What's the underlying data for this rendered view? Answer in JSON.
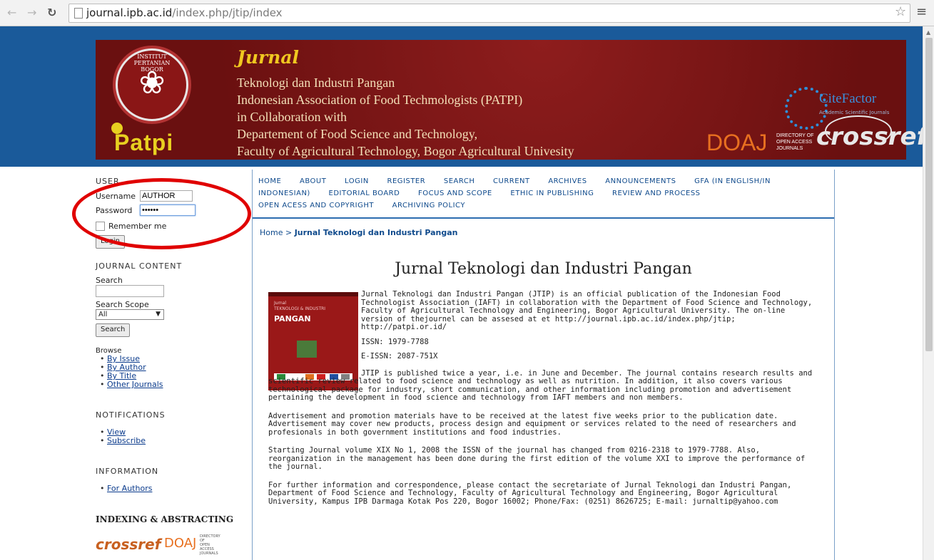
{
  "browser": {
    "url_host": "journal.ipb.ac.id",
    "url_path": "/index.php/jtip/index",
    "back_icon": "arrow-left",
    "forward_icon": "arrow-right",
    "reload_icon": "reload"
  },
  "banner": {
    "title": "Jurnal",
    "lines": [
      "Teknologi dan Industri Pangan",
      "Indonesian Association of Food Techmologists (PATPI)",
      "in Collaboration with",
      "Departement of Food Science and Technology,",
      "Faculty of Agricultural Technology, Bogor Agricultural Univesity"
    ],
    "crest_text": "INSTITUT PERTANIAN BOGOR",
    "patpi_logo": "Patpi",
    "citefactor": "CiteFactor",
    "citefactor_sub": "Academic Scientific Journals",
    "doaj": "DOAJ",
    "doaj_sub": [
      "DIRECTORY OF",
      "OPEN ACCESS",
      "JOURNALS"
    ],
    "crossref": "crossref"
  },
  "sidebar": {
    "user_title": "USER",
    "username_label": "Username",
    "username_value": "AUTHOR",
    "password_label": "Password",
    "password_value": "••••••",
    "remember_label": "Remember me",
    "login_button": "Login",
    "journal_content_title": "JOURNAL CONTENT",
    "search_label": "Search",
    "search_scope_label": "Search Scope",
    "search_scope_value": "All",
    "search_button": "Search",
    "browse_label": "Browse",
    "browse_links": [
      "By Issue",
      "By Author",
      "By Title",
      "Other Journals"
    ],
    "notifications_title": "NOTIFICATIONS",
    "notification_links": [
      "View",
      "Subscribe"
    ],
    "information_title": "INFORMATION",
    "information_links": [
      "For Authors"
    ],
    "indexing_title": "INDEXING & ABSTRACTING",
    "indexing_crossref": "crossref",
    "indexing_doaj": "DOAJ",
    "indexing_doaj_sub": [
      "DIRECTORY OF",
      "OPEN ACCESS",
      "JOURNALS"
    ]
  },
  "nav": {
    "items": [
      "HOME",
      "ABOUT",
      "LOGIN",
      "REGISTER",
      "SEARCH",
      "CURRENT",
      "ARCHIVES",
      "ANNOUNCEMENTS",
      "GFA (IN ENGLISH/IN INDONESIAN)",
      "EDITORIAL BOARD",
      "FOCUS AND SCOPE",
      "ETHIC IN PUBLISHING",
      "REVIEW AND PROCESS",
      "OPEN ACESS AND COPYRIGHT",
      "ARCHIVING POLICY"
    ]
  },
  "breadcrumb": {
    "home": "Home",
    "separator": ">",
    "current": "Jurnal Teknologi dan Industri Pangan"
  },
  "main": {
    "title": "Jurnal Teknologi dan Industri Pangan",
    "cover": {
      "small_top": "Jurnal",
      "small_sub": "TEKNOLOGI & INDUSTRI",
      "big": "PANGAN"
    },
    "intro": "Jurnal Teknologi dan Industri Pangan (JTIP) is an official publication of the Indonesian Food Technologist Association (IAFT) in collaboration with the Department of Food Science and Technology, Faculty of Agricultural Technology and Engineering, Bogor Agricultural University. The on-line version of thejournel can be assesed at et  http://journal.ipb.ac.id/index.php/jtip; http://patpi.or.id/",
    "issn": "ISSN: 1979-7788",
    "eissn": "E-ISSN: 2087-751X",
    "para1": "JTIP is published twice a year, i.e. in June and December. The journal contains research results and scientific review related to food science and technology as well as nutrition. In addition, it also covers various technological package for industry, short communication, and other information including promotion and advertisement pertaining the development in food science and technology from IAFT members and non members.",
    "para2": "Advertisement and promotion materials have to be received at the latest five weeks prior to the publication date. Advertisement may cover new products, process design and equipment or services related to the need of researchers and profesionals in both government institutions and food industries.",
    "para3": "Starting Journal volume XIX No 1, 2008 the ISSN of the journal has changed from 0216-2318 to 1979-7788. Also, reorganization in the management has been done during the first edition of the volume XXI to improve the performance of the journal.",
    "para4": "For further information and correspondence, please contact the secretariate of Jurnal Teknologi dan Industri Pangan, Department of Food Science and Technology, Faculty of Agricultural Technology and Engineering, Bogor Agricultural University, Kampus IPB Darmaga Kotak Pos 220, Bogor 16002; Phone/Fax: (0251) 8626725; E-mail: jurnaltip@yahoo.com"
  },
  "colors": {
    "banner_bg": "#7a1515",
    "page_bg": "#1a5a9a",
    "link": "#0f4a8c",
    "highlight_oval": "#e00000"
  }
}
